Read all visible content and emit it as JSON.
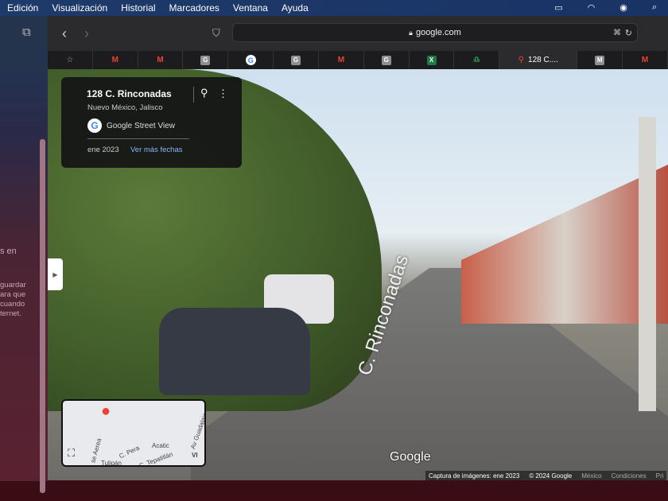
{
  "menubar": {
    "items": [
      "Edición",
      "Visualización",
      "Historial",
      "Marcadores",
      "Ventana",
      "Ayuda"
    ]
  },
  "sidebar": {
    "text": [
      "s en",
      "guardar",
      "ara que",
      "cuando",
      "ternet."
    ]
  },
  "toolbar": {
    "url": "google.com"
  },
  "tabs": [
    {
      "icon": "star"
    },
    {
      "icon": "M"
    },
    {
      "icon": "M"
    },
    {
      "icon": "G"
    },
    {
      "icon": "G"
    },
    {
      "icon": "G"
    },
    {
      "icon": "M"
    },
    {
      "icon": "G"
    },
    {
      "icon": "X"
    },
    {
      "icon": "~"
    },
    {
      "icon": "maps",
      "label": "128 C...."
    },
    {
      "icon": "M"
    },
    {
      "icon": "M"
    }
  ],
  "card": {
    "title": "128 C. Rinconadas",
    "subtitle": "Nuevo México, Jalisco",
    "service": "Google Street View",
    "date": "ene 2023",
    "more_dates": "Ver más fechas"
  },
  "street_label": "C. Rinconadas",
  "minimap": {
    "labels": [
      "Acatic",
      "C. Pera",
      "Av Guadalajara",
      "C. Tepatitlán",
      "se Aerea",
      "Tulipán",
      "VI"
    ]
  },
  "attribution": {
    "capture": "Captura de imágenes: ene 2023",
    "copyright": "© 2024 Google",
    "country": "México",
    "terms": "Condiciones",
    "privacy": "Pri"
  },
  "google_logo": "Google"
}
